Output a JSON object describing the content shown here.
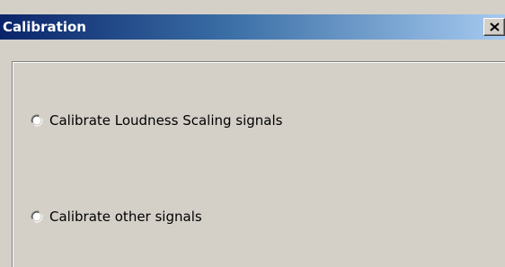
{
  "window": {
    "title": "Calibration",
    "close_label": "×"
  },
  "options": [
    {
      "label": "Calibrate Loudness Scaling signals",
      "selected": false
    },
    {
      "label": "Calibrate other signals",
      "selected": false
    }
  ],
  "colors": {
    "titlebar_start": "#0a246a",
    "titlebar_end": "#a6caf0",
    "window_bg": "#d4d0c8"
  },
  "icons": {
    "close": "close-icon",
    "radio": "radio-icon"
  }
}
